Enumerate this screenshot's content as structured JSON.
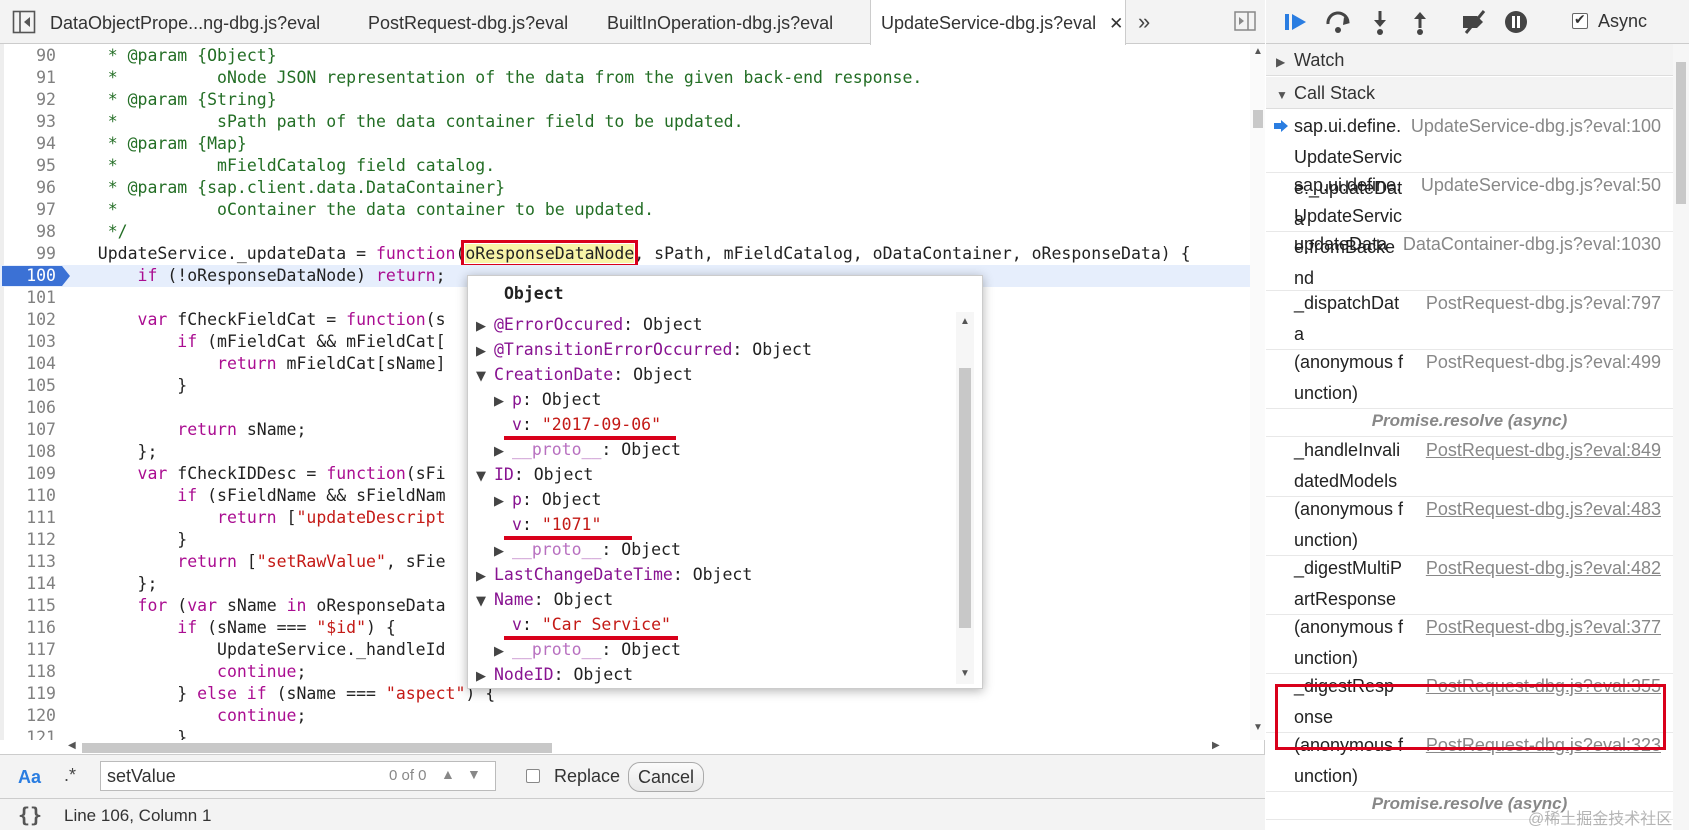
{
  "tabs": [
    {
      "label": "DataObjectPrope...ng-dbg.js?eval"
    },
    {
      "label": "PostRequest-dbg.js?eval"
    },
    {
      "label": "BuiltInOperation-dbg.js?eval"
    },
    {
      "label": "UpdateService-dbg.js?eval",
      "active": true
    }
  ],
  "tab_close_glyph": "✕",
  "tabs_more_glyph": "»",
  "code_lines": [
    {
      "n": "90",
      "html": "    <span class=\"c\">* @param {Object}</span>"
    },
    {
      "n": "91",
      "html": "    <span class=\"c\">*          oNode JSON representation of the data from the given back-end response.</span>"
    },
    {
      "n": "92",
      "html": "    <span class=\"c\">* @param {String}</span>"
    },
    {
      "n": "93",
      "html": "    <span class=\"c\">*          sPath path of the data container field to be updated.</span>"
    },
    {
      "n": "94",
      "html": "    <span class=\"c\">* @param {Map}</span>"
    },
    {
      "n": "95",
      "html": "    <span class=\"c\">*          mFieldCatalog field catalog.</span>"
    },
    {
      "n": "96",
      "html": "    <span class=\"c\">* @param {sap.client.data.DataContainer}</span>"
    },
    {
      "n": "97",
      "html": "    <span class=\"c\">*          oContainer the data container to be updated.</span>"
    },
    {
      "n": "98",
      "html": "    <span class=\"c\">*/</span>"
    },
    {
      "n": "99",
      "html": "   UpdateService._updateData = <span class=\"k\">function</span>(<span class=\"hl\">oResponseDataNode</span>, sPath, mFieldCatalog, oDataContainer, oResponseData) {"
    },
    {
      "n": "100",
      "html": "       <span class=\"k\">if</span> (!oResponseDataNode) <span class=\"k\">return</span>;",
      "current": true
    },
    {
      "n": "101",
      "html": ""
    },
    {
      "n": "102",
      "html": "       <span class=\"k\">var</span> fCheckFieldCat = <span class=\"k\">function</span>(s"
    },
    {
      "n": "103",
      "html": "           <span class=\"k\">if</span> (mFieldCat &amp;&amp; mFieldCat["
    },
    {
      "n": "104",
      "html": "               <span class=\"k\">return</span> mFieldCat[sName]"
    },
    {
      "n": "105",
      "html": "           }"
    },
    {
      "n": "106",
      "html": ""
    },
    {
      "n": "107",
      "html": "           <span class=\"k\">return</span> sName;"
    },
    {
      "n": "108",
      "html": "       };"
    },
    {
      "n": "109",
      "html": "       <span class=\"k\">var</span> fCheckIDDesc = <span class=\"k\">function</span>(sFi"
    },
    {
      "n": "110",
      "html": "           <span class=\"k\">if</span> (sFieldName &amp;&amp; sFieldNam"
    },
    {
      "n": "111",
      "html": "               <span class=\"k\">return</span> [<span class=\"s\">\"updateDescript</span>"
    },
    {
      "n": "112",
      "html": "           }"
    },
    {
      "n": "113",
      "html": "           <span class=\"k\">return</span> [<span class=\"s\">\"setRawValue\"</span>, sFie"
    },
    {
      "n": "114",
      "html": "       };"
    },
    {
      "n": "115",
      "html": "       <span class=\"k\">for</span> (<span class=\"k\">var</span> sName <span class=\"k\">in</span> oResponseData"
    },
    {
      "n": "116",
      "html": "           <span class=\"k\">if</span> (sName === <span class=\"s\">\"$id\"</span>) {"
    },
    {
      "n": "117",
      "html": "               UpdateService._handleId"
    },
    {
      "n": "118",
      "html": "               <span class=\"k\">continue</span>;"
    },
    {
      "n": "119",
      "html": "           } <span class=\"k\">else if</span> (sName === <span class=\"s\">\"aspect\"</span>) {"
    },
    {
      "n": "120",
      "html": "               <span class=\"k\">continue</span>;"
    },
    {
      "n": "121",
      "html": "           }"
    }
  ],
  "popover": {
    "title": "Object",
    "nodes": [
      {
        "depth": 0,
        "open": false,
        "key": "@ErrorOccured",
        "sep": ": ",
        "val": "Object"
      },
      {
        "depth": 0,
        "open": false,
        "key": "@TransitionErrorOccurred",
        "sep": ": ",
        "val": "Object"
      },
      {
        "depth": 0,
        "open": true,
        "key": "CreationDate",
        "sep": ": ",
        "val": "Object"
      },
      {
        "depth": 1,
        "open": false,
        "key": "p",
        "sep": ": ",
        "val": "Object"
      },
      {
        "depth": 1,
        "leaf": true,
        "key": "v",
        "sep": ": ",
        "str": "\"2017-09-06\"",
        "underline": 158
      },
      {
        "depth": 1,
        "open": false,
        "key": "__proto__",
        "sep": ": ",
        "val": "Object",
        "dim": true
      },
      {
        "depth": 0,
        "open": true,
        "key": "ID",
        "sep": ": ",
        "val": "Object"
      },
      {
        "depth": 1,
        "open": false,
        "key": "p",
        "sep": ": ",
        "val": "Object"
      },
      {
        "depth": 1,
        "leaf": true,
        "key": "v",
        "sep": ": ",
        "str": "\"1071\"",
        "underline": 114
      },
      {
        "depth": 1,
        "open": false,
        "key": "__proto__",
        "sep": ": ",
        "val": "Object",
        "dim": true
      },
      {
        "depth": 0,
        "open": false,
        "key": "LastChangeDateTime",
        "sep": ": ",
        "val": "Object"
      },
      {
        "depth": 0,
        "open": true,
        "key": "Name",
        "sep": ": ",
        "val": "Object"
      },
      {
        "depth": 1,
        "leaf": true,
        "key": "v",
        "sep": ": ",
        "str": "\"Car Service\"",
        "underline": 160
      },
      {
        "depth": 1,
        "open": false,
        "key": "__proto__",
        "sep": ": ",
        "val": "Object",
        "dim": true
      },
      {
        "depth": 0,
        "open": false,
        "key": "NodeID",
        "sep": ": ",
        "val": "Object"
      }
    ]
  },
  "search": {
    "case_label": "Aa",
    "regex_label": ".*",
    "value": "setValue",
    "match_count": "0 of 0",
    "prev_glyph": "▲",
    "next_glyph": "▼",
    "replace_label": "Replace",
    "cancel_label": "Cancel"
  },
  "status": {
    "pretty_print": "{}",
    "cursor": "Line 106, Column 1"
  },
  "debugger": {
    "async_label": "Async",
    "watch_label": "Watch",
    "callstack_label": "Call Stack",
    "frames": [
      {
        "type": "frame",
        "name": "sap.ui.define.UpdateService._updateData",
        "loc": "UpdateService-dbg.js?eval:100",
        "selected": true,
        "link": false
      },
      {
        "type": "frame",
        "name": "sap.ui.define.UpdateService.fromBackend",
        "loc": "UpdateService-dbg.js?eval:50",
        "link": false
      },
      {
        "type": "frame",
        "name": "updateData",
        "loc": "DataContainer-dbg.js?eval:1030",
        "link": false
      },
      {
        "type": "frame",
        "name": "_dispatchData",
        "loc": "PostRequest-dbg.js?eval:797",
        "link": false
      },
      {
        "type": "frame",
        "name": "(anonymous function)",
        "loc": "PostRequest-dbg.js?eval:499",
        "link": false
      },
      {
        "type": "async",
        "label": "Promise.resolve (async)"
      },
      {
        "type": "frame",
        "name": "_handleInvalidatedModels",
        "loc": "PostRequest-dbg.js?eval:849",
        "link": true
      },
      {
        "type": "frame",
        "name": "(anonymous function)",
        "loc": "PostRequest-dbg.js?eval:483",
        "link": true
      },
      {
        "type": "frame",
        "name": "_digestMultiPartResponse",
        "loc": "PostRequest-dbg.js?eval:482",
        "link": true
      },
      {
        "type": "frame",
        "name": "(anonymous function)",
        "loc": "PostRequest-dbg.js?eval:377",
        "link": true
      },
      {
        "type": "frame",
        "name": "_digestResponse",
        "loc": "PostRequest-dbg.js?eval:355",
        "link": true
      },
      {
        "type": "frame",
        "name": "(anonymous function)",
        "loc": "PostRequest-dbg.js?eval:323",
        "link": true
      },
      {
        "type": "async",
        "label": "Promise.resolve (async)"
      }
    ]
  },
  "watermark": "@稀土掘金技术社区",
  "colors": {
    "accent_blue": "#3b71d5",
    "annotation_red": "#d9001b",
    "comment_green": "#236e25",
    "keyword_purple": "#aa0d91",
    "string_red": "#c41a16"
  }
}
